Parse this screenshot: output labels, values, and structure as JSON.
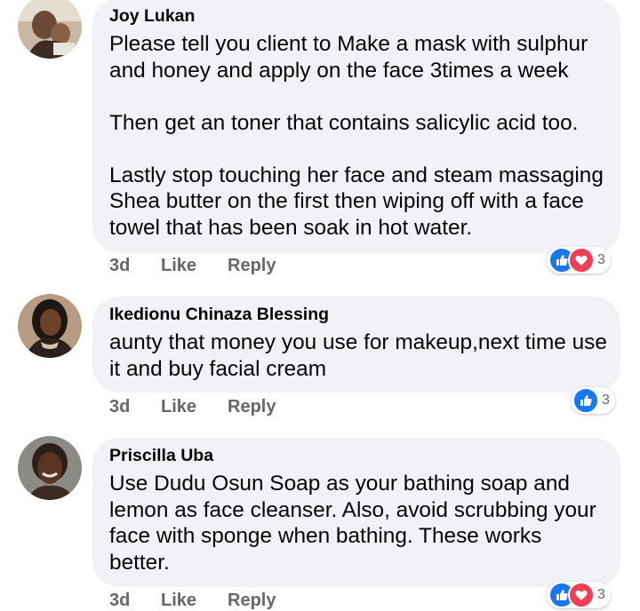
{
  "comments": [
    {
      "author": "Joy Lukan",
      "paragraphs": [
        [
          "Please tell you client to Make a mask with sulphur",
          "and honey and apply on the face  3times a week"
        ],
        [
          "Then get an toner that contains salicylic acid too."
        ],
        [
          "Lastly stop touching her face and steam massaging",
          "Shea butter on the first then wiping off with a face",
          "towel that has been soak in hot water."
        ]
      ],
      "time": "3d",
      "like_label": "Like",
      "reply_label": "Reply",
      "reactions": [
        "like",
        "love"
      ],
      "reaction_count": "3"
    },
    {
      "author": "Ikedionu Chinaza Blessing",
      "paragraphs": [
        [
          "aunty that money you use for makeup,next time use",
          "it and buy facial cream"
        ]
      ],
      "time": "3d",
      "like_label": "Like",
      "reply_label": "Reply",
      "reactions": [
        "like"
      ],
      "reaction_count": "3"
    },
    {
      "author": "Priscilla Uba",
      "paragraphs": [
        [
          "Use Dudu Osun Soap as your bathing soap and",
          "lemon as face cleanser. Also, avoid scrubbing your",
          "face with sponge when bathing. These works",
          "better."
        ]
      ],
      "time": "3d",
      "like_label": "Like",
      "reply_label": "Reply",
      "reactions": [
        "like",
        "love"
      ],
      "reaction_count": "3"
    }
  ],
  "colors": {
    "bubble": "#f0f2f5",
    "meta_text": "#65676b",
    "like_blue": "#1877f2",
    "love_red": "#f33e58"
  }
}
